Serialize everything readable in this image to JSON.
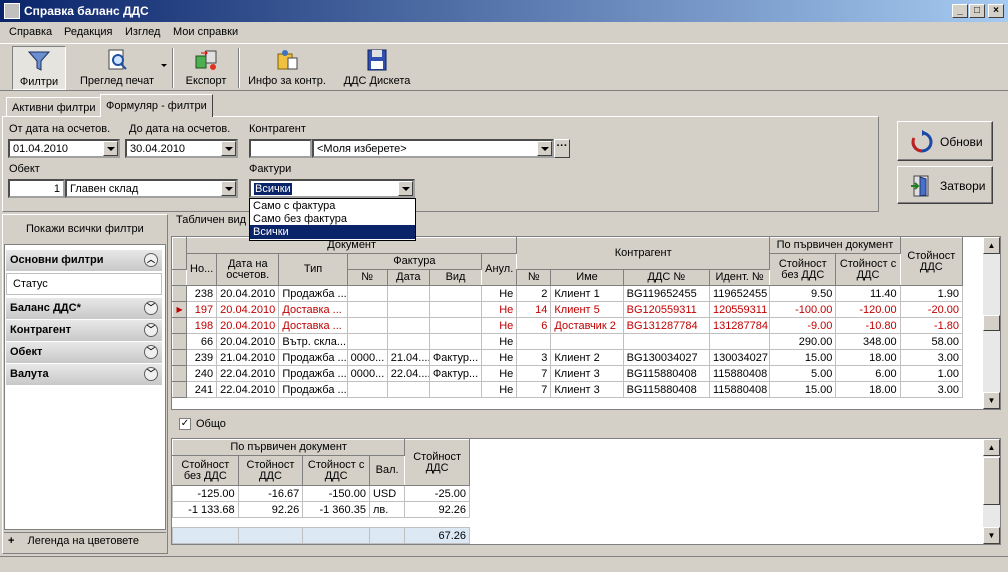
{
  "window": {
    "title": "Справка баланс ДДС"
  },
  "menu": [
    "Справка",
    "Редакция",
    "Изглед",
    "Мои справки"
  ],
  "toolbar": {
    "filters": "Филтри",
    "print_preview": "Преглед печат",
    "export": "Експорт",
    "counterparty_info": "Инфо за контр.",
    "vat_disk": "ДДС Дискета"
  },
  "tabs": [
    "Активни филтри",
    "Формуляр - филтри"
  ],
  "form": {
    "from_date_label": "От дата на осчетов.",
    "from_date": "01.04.2010",
    "to_date_label": "До дата на осчетов.",
    "to_date": "30.04.2010",
    "counterparty_label": "Контрагент",
    "counterparty_value": "<Моля изберете>",
    "object_label": "Обект",
    "object_code": "1",
    "object_name": "Главен склад",
    "invoices_label": "Фактури",
    "invoices_value": "Всички",
    "invoice_options": [
      "Само с фактура",
      "Само без фактура",
      "Всички"
    ]
  },
  "buttons": {
    "refresh": "Обнови",
    "close": "Затвори"
  },
  "left_panel": {
    "show_all": "Покажи всички филтри",
    "groups": [
      {
        "label": "Основни филтри",
        "expanded": true,
        "items": [
          "Статус"
        ]
      },
      {
        "label": "Баланс ДДС*"
      },
      {
        "label": "Контрагент"
      },
      {
        "label": "Обект"
      },
      {
        "label": "Валута"
      }
    ],
    "legend": "Легенда на цветовете"
  },
  "table_view_label": "Табличен вид",
  "grid": {
    "group_headers": {
      "document": "Документ",
      "invoice": "Фактура",
      "counterparty": "Контрагент",
      "primary_doc": "По първичен документ"
    },
    "columns": [
      "Но...",
      "Дата на осчетов.",
      "Тип",
      "№",
      "Дата",
      "Вид",
      "Анул.",
      "№",
      "Име",
      "ДДС №",
      "Идент. №",
      "Стойност без ДДС",
      "Стойност с ДДС",
      "Стойност ДДС"
    ],
    "rows": [
      {
        "cells": [
          "238",
          "20.04.2010",
          "Продажба ...",
          "",
          "",
          "",
          "Не",
          "2",
          "Клиент 1",
          "BG119652455",
          "119652455",
          "9.50",
          "11.40",
          "1.90"
        ],
        "red": false,
        "current": false
      },
      {
        "cells": [
          "197",
          "20.04.2010",
          "Доставка ...",
          "",
          "",
          "",
          "Не",
          "14",
          "Клиент 5",
          "BG120559311",
          "120559311",
          "-100.00",
          "-120.00",
          "-20.00"
        ],
        "red": true,
        "current": true
      },
      {
        "cells": [
          "198",
          "20.04.2010",
          "Доставка ...",
          "",
          "",
          "",
          "Не",
          "6",
          "Доставчик 2",
          "BG131287784",
          "131287784",
          "-9.00",
          "-10.80",
          "-1.80"
        ],
        "red": true,
        "current": false
      },
      {
        "cells": [
          "66",
          "20.04.2010",
          "Вътр. скла...",
          "",
          "",
          "",
          "Не",
          "",
          "",
          "",
          "",
          "290.00",
          "348.00",
          "58.00"
        ],
        "red": false,
        "current": false
      },
      {
        "cells": [
          "239",
          "21.04.2010",
          "Продажба ...",
          "0000...",
          "21.04....",
          "Фактур...",
          "Не",
          "3",
          "Клиент 2",
          "BG130034027",
          "130034027",
          "15.00",
          "18.00",
          "3.00"
        ],
        "red": false,
        "current": false
      },
      {
        "cells": [
          "240",
          "22.04.2010",
          "Продажба ...",
          "0000...",
          "22.04....",
          "Фактур...",
          "Не",
          "7",
          "Клиент 3",
          "BG115880408",
          "115880408",
          "5.00",
          "6.00",
          "1.00"
        ],
        "red": false,
        "current": false
      },
      {
        "cells": [
          "241",
          "22.04.2010",
          "Продажба ...",
          "",
          "",
          "",
          "Не",
          "7",
          "Клиент 3",
          "BG115880408",
          "115880408",
          "15.00",
          "18.00",
          "3.00"
        ],
        "red": false,
        "current": false
      }
    ]
  },
  "total_checkbox": "Общо",
  "summary": {
    "group_header": "По първичен документ",
    "columns": [
      "Стойност без ДДС",
      "Стойност ДДС",
      "Стойност с ДДС",
      "Вал.",
      "Стойност ДДС"
    ],
    "rows": [
      [
        "-125.00",
        "-16.67",
        "-150.00",
        "USD",
        "-25.00"
      ],
      [
        "-1 133.68",
        "92.26",
        "-1 360.35",
        "лв.",
        "92.26"
      ]
    ],
    "footer": [
      "",
      "",
      "",
      "",
      "67.26"
    ]
  }
}
